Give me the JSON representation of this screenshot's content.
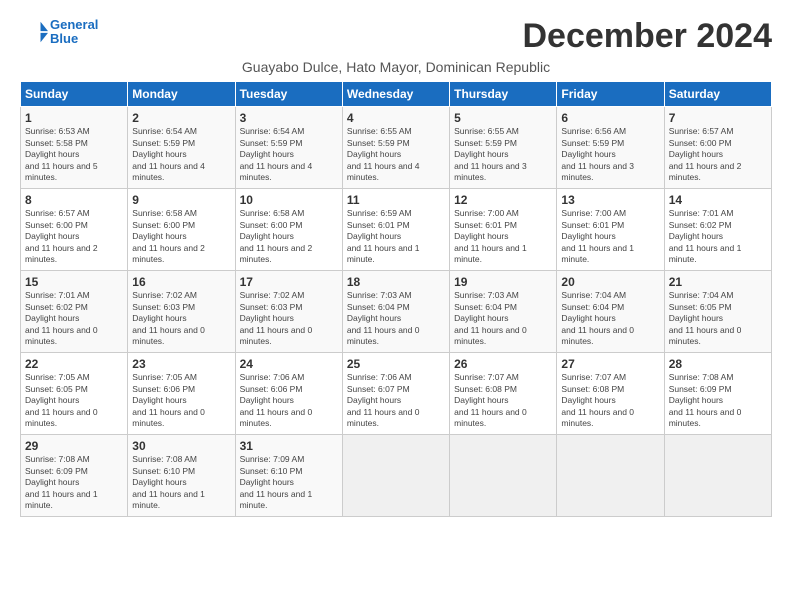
{
  "logo": {
    "line1": "General",
    "line2": "Blue"
  },
  "title": "December 2024",
  "subtitle": "Guayabo Dulce, Hato Mayor, Dominican Republic",
  "days_header": [
    "Sunday",
    "Monday",
    "Tuesday",
    "Wednesday",
    "Thursday",
    "Friday",
    "Saturday"
  ],
  "weeks": [
    [
      {
        "num": "1",
        "rise": "6:53 AM",
        "set": "5:58 PM",
        "daylight": "11 hours and 5 minutes."
      },
      {
        "num": "2",
        "rise": "6:54 AM",
        "set": "5:59 PM",
        "daylight": "11 hours and 4 minutes."
      },
      {
        "num": "3",
        "rise": "6:54 AM",
        "set": "5:59 PM",
        "daylight": "11 hours and 4 minutes."
      },
      {
        "num": "4",
        "rise": "6:55 AM",
        "set": "5:59 PM",
        "daylight": "11 hours and 4 minutes."
      },
      {
        "num": "5",
        "rise": "6:55 AM",
        "set": "5:59 PM",
        "daylight": "11 hours and 3 minutes."
      },
      {
        "num": "6",
        "rise": "6:56 AM",
        "set": "5:59 PM",
        "daylight": "11 hours and 3 minutes."
      },
      {
        "num": "7",
        "rise": "6:57 AM",
        "set": "6:00 PM",
        "daylight": "11 hours and 2 minutes."
      }
    ],
    [
      {
        "num": "8",
        "rise": "6:57 AM",
        "set": "6:00 PM",
        "daylight": "11 hours and 2 minutes."
      },
      {
        "num": "9",
        "rise": "6:58 AM",
        "set": "6:00 PM",
        "daylight": "11 hours and 2 minutes."
      },
      {
        "num": "10",
        "rise": "6:58 AM",
        "set": "6:00 PM",
        "daylight": "11 hours and 2 minutes."
      },
      {
        "num": "11",
        "rise": "6:59 AM",
        "set": "6:01 PM",
        "daylight": "11 hours and 1 minute."
      },
      {
        "num": "12",
        "rise": "7:00 AM",
        "set": "6:01 PM",
        "daylight": "11 hours and 1 minute."
      },
      {
        "num": "13",
        "rise": "7:00 AM",
        "set": "6:01 PM",
        "daylight": "11 hours and 1 minute."
      },
      {
        "num": "14",
        "rise": "7:01 AM",
        "set": "6:02 PM",
        "daylight": "11 hours and 1 minute."
      }
    ],
    [
      {
        "num": "15",
        "rise": "7:01 AM",
        "set": "6:02 PM",
        "daylight": "11 hours and 0 minutes."
      },
      {
        "num": "16",
        "rise": "7:02 AM",
        "set": "6:03 PM",
        "daylight": "11 hours and 0 minutes."
      },
      {
        "num": "17",
        "rise": "7:02 AM",
        "set": "6:03 PM",
        "daylight": "11 hours and 0 minutes."
      },
      {
        "num": "18",
        "rise": "7:03 AM",
        "set": "6:04 PM",
        "daylight": "11 hours and 0 minutes."
      },
      {
        "num": "19",
        "rise": "7:03 AM",
        "set": "6:04 PM",
        "daylight": "11 hours and 0 minutes."
      },
      {
        "num": "20",
        "rise": "7:04 AM",
        "set": "6:04 PM",
        "daylight": "11 hours and 0 minutes."
      },
      {
        "num": "21",
        "rise": "7:04 AM",
        "set": "6:05 PM",
        "daylight": "11 hours and 0 minutes."
      }
    ],
    [
      {
        "num": "22",
        "rise": "7:05 AM",
        "set": "6:05 PM",
        "daylight": "11 hours and 0 minutes."
      },
      {
        "num": "23",
        "rise": "7:05 AM",
        "set": "6:06 PM",
        "daylight": "11 hours and 0 minutes."
      },
      {
        "num": "24",
        "rise": "7:06 AM",
        "set": "6:06 PM",
        "daylight": "11 hours and 0 minutes."
      },
      {
        "num": "25",
        "rise": "7:06 AM",
        "set": "6:07 PM",
        "daylight": "11 hours and 0 minutes."
      },
      {
        "num": "26",
        "rise": "7:07 AM",
        "set": "6:08 PM",
        "daylight": "11 hours and 0 minutes."
      },
      {
        "num": "27",
        "rise": "7:07 AM",
        "set": "6:08 PM",
        "daylight": "11 hours and 0 minutes."
      },
      {
        "num": "28",
        "rise": "7:08 AM",
        "set": "6:09 PM",
        "daylight": "11 hours and 0 minutes."
      }
    ],
    [
      {
        "num": "29",
        "rise": "7:08 AM",
        "set": "6:09 PM",
        "daylight": "11 hours and 1 minute."
      },
      {
        "num": "30",
        "rise": "7:08 AM",
        "set": "6:10 PM",
        "daylight": "11 hours and 1 minute."
      },
      {
        "num": "31",
        "rise": "7:09 AM",
        "set": "6:10 PM",
        "daylight": "11 hours and 1 minute."
      },
      null,
      null,
      null,
      null
    ]
  ]
}
